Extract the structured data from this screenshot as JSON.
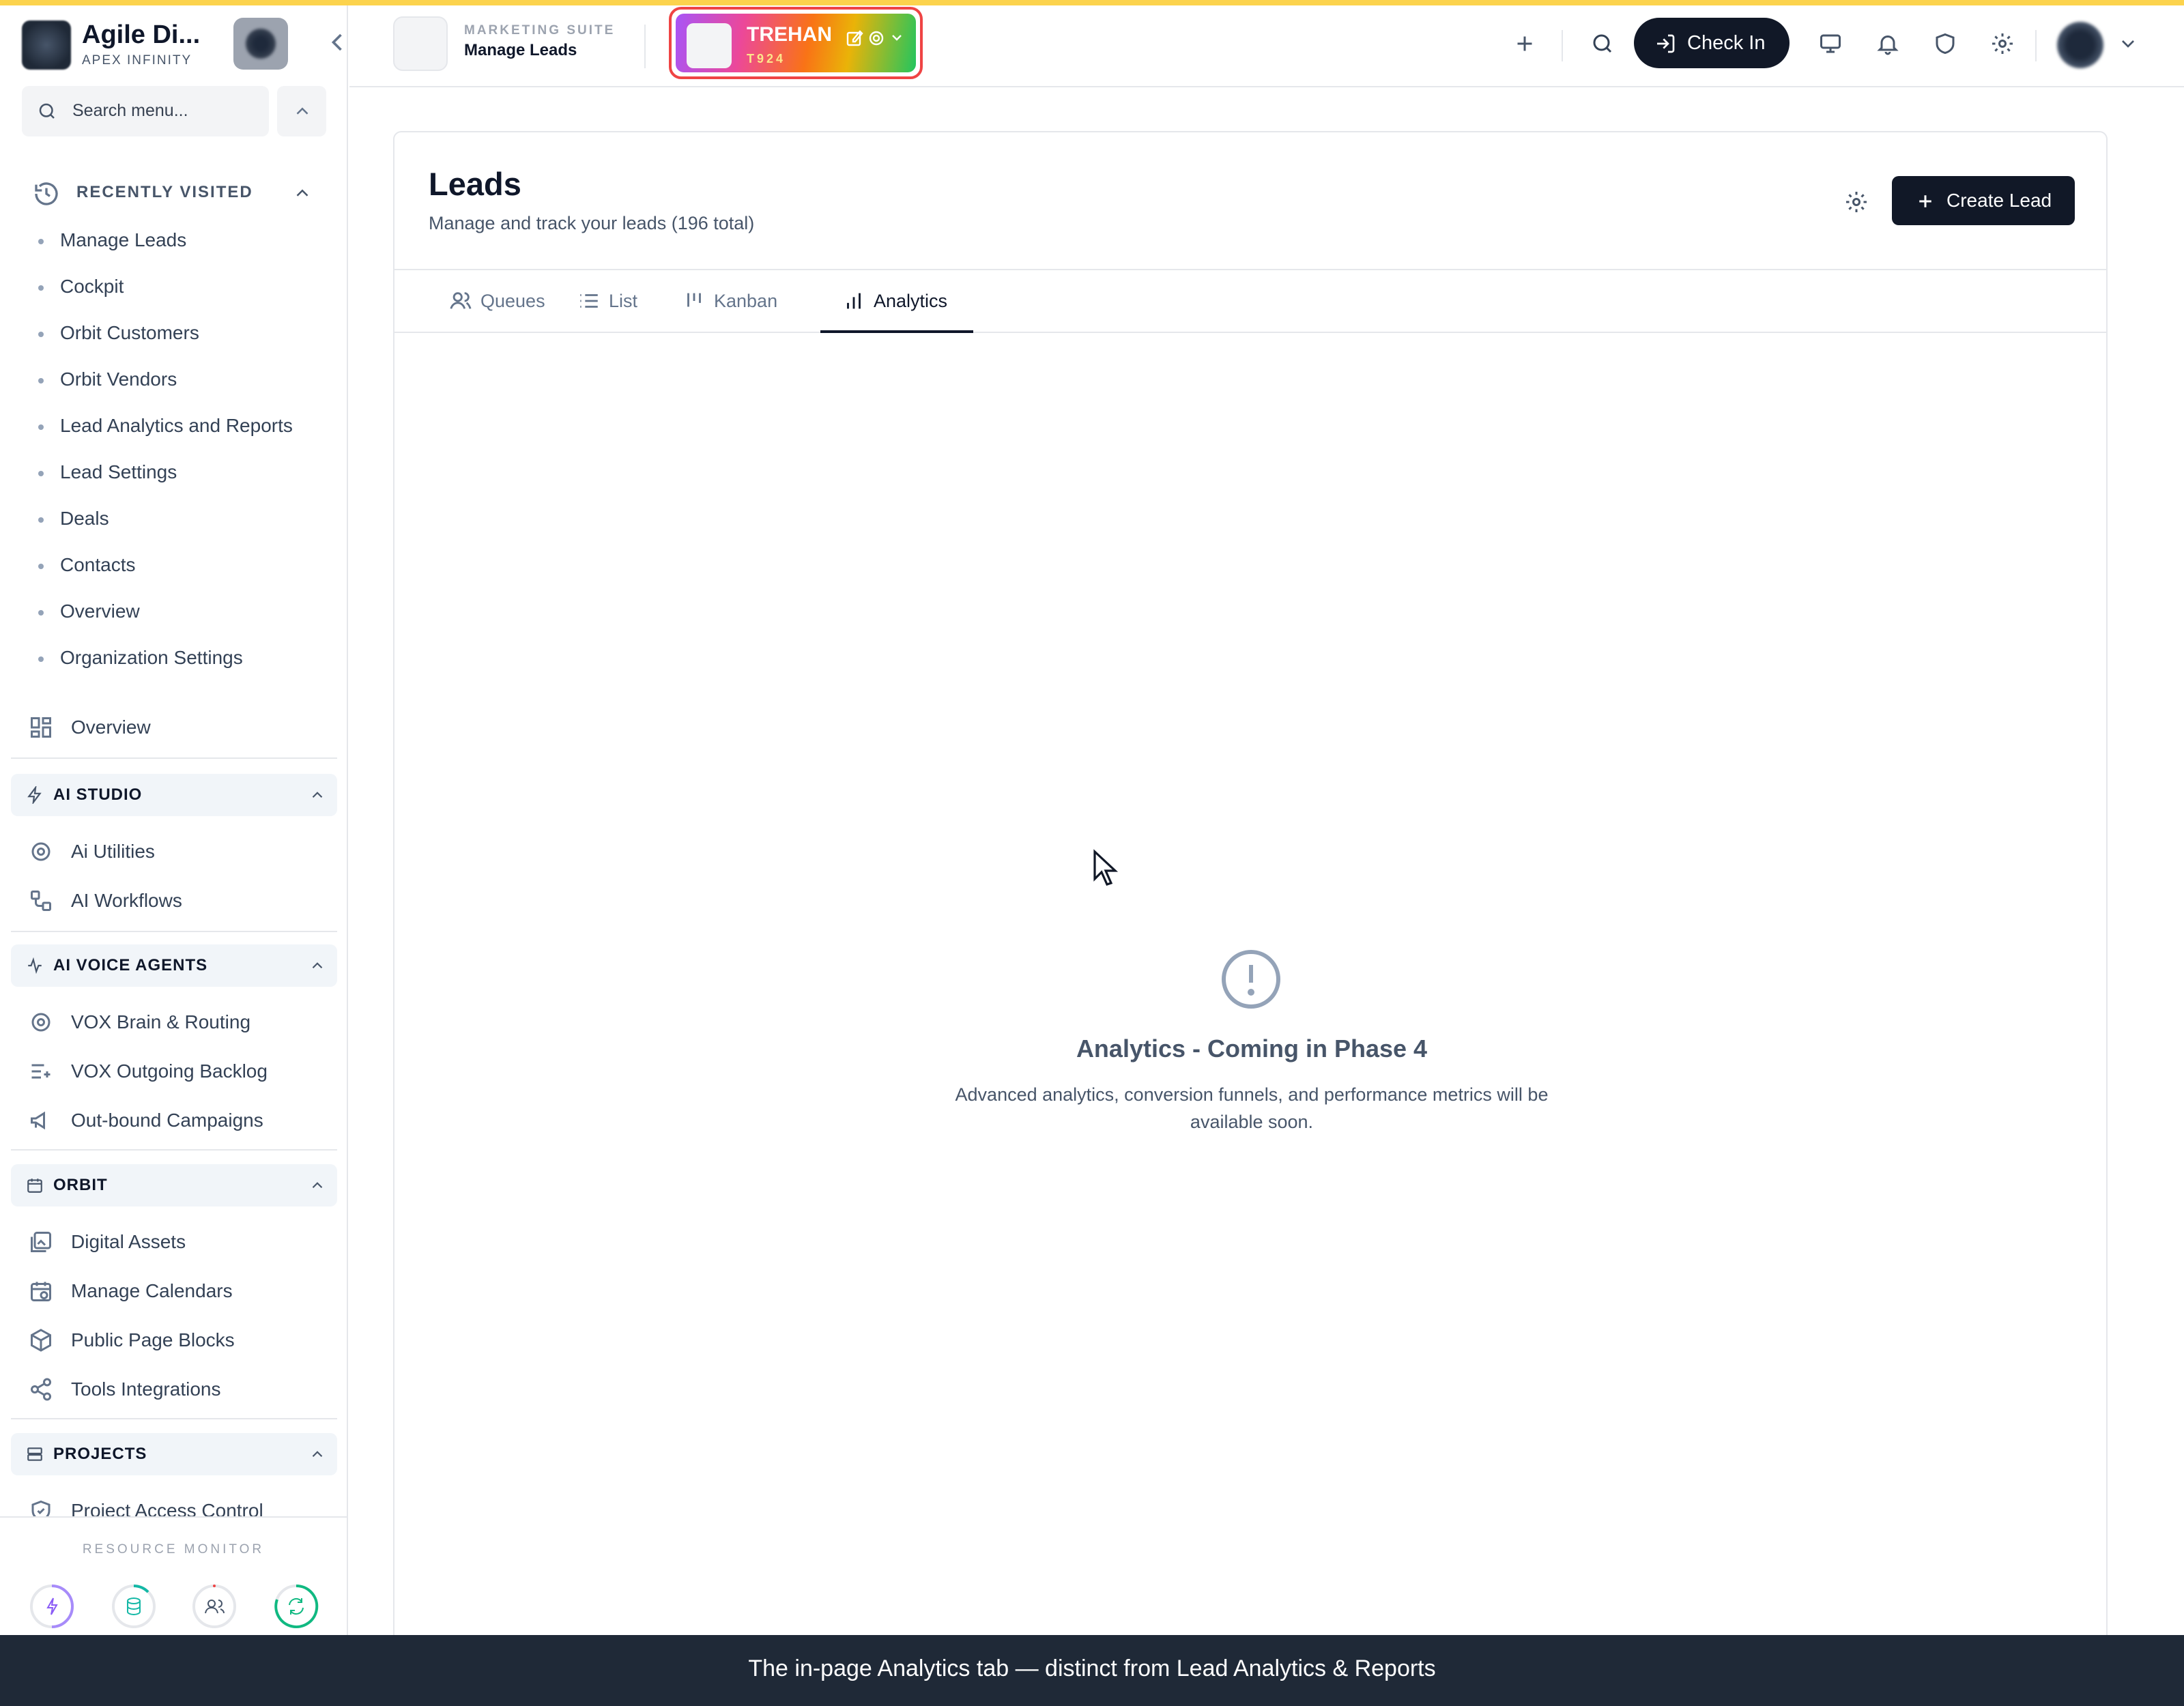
{
  "sidebar": {
    "brand_name": "Agile Di...",
    "brand_sub": "APEX INFINITY",
    "search_placeholder": "Search menu...",
    "recently_visited": {
      "title": "RECENTLY VISITED",
      "items": [
        "Manage Leads",
        "Cockpit",
        "Orbit Customers",
        "Orbit Vendors",
        "Lead Analytics and Reports",
        "Lead Settings",
        "Deals",
        "Contacts",
        "Overview",
        "Organization Settings"
      ]
    },
    "overview_label": "Overview",
    "groups": [
      {
        "title": "AI STUDIO",
        "items": [
          "Ai Utilities",
          "AI Workflows"
        ]
      },
      {
        "title": "AI VOICE AGENTS",
        "items": [
          "VOX Brain & Routing",
          "VOX Outgoing Backlog",
          "Out-bound Campaigns"
        ]
      },
      {
        "title": "ORBIT",
        "items": [
          "Digital Assets",
          "Manage Calendars",
          "Public Page Blocks",
          "Tools Integrations"
        ]
      },
      {
        "title": "PROJECTS",
        "items": [
          "Project Access Control"
        ]
      }
    ],
    "resource_monitor_label": "RESOURCE MONITOR"
  },
  "header": {
    "suite_label": "MARKETING SUITE",
    "page_label": "Manage Leads",
    "tenant_name": "TREHAN",
    "tenant_code": "T924",
    "checkin_label": "Check In"
  },
  "main": {
    "title": "Leads",
    "subtitle": "Manage and track your leads (196 total)",
    "create_label": "Create Lead",
    "tabs": [
      {
        "label": "Queues",
        "icon": "users-icon"
      },
      {
        "label": "List",
        "icon": "list-icon"
      },
      {
        "label": "Kanban",
        "icon": "kanban-icon"
      },
      {
        "label": "Analytics",
        "icon": "bar-chart-icon",
        "active": true
      }
    ],
    "empty_title": "Analytics - Coming in Phase 4",
    "empty_desc": "Advanced analytics, conversion funnels, and performance metrics will be available soon."
  },
  "caption": "The in-page Analytics tab — distinct from Lead Analytics & Reports",
  "colors": {
    "accent": "#111827",
    "stripe": "#fcd34d",
    "tenant_border": "#ef4444"
  }
}
